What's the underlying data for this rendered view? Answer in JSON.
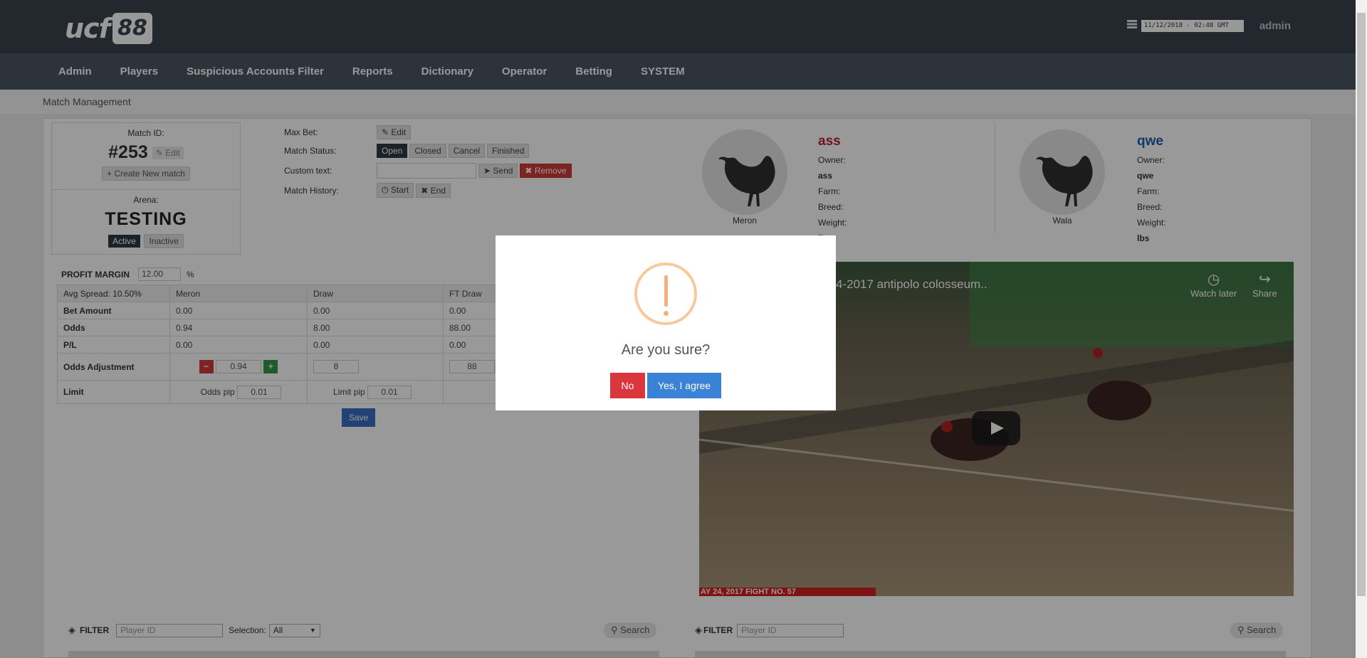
{
  "brand": {
    "logo_part1": "ucf",
    "logo_part2": "88"
  },
  "header": {
    "datetime": "11/12/2018 - 02:48 GMT",
    "user": "admin"
  },
  "nav": {
    "items": [
      "Admin",
      "Players",
      "Suspicious Accounts Filter",
      "Reports",
      "Dictionary",
      "Operator",
      "Betting",
      "SYSTEM"
    ]
  },
  "breadcrumb": "Match Management",
  "match": {
    "id_label": "Match ID:",
    "id": "#253",
    "edit_label": "Edit",
    "create_label": "Create New match",
    "arena_label": "Arena:",
    "arena": "TESTING",
    "active_label": "Active",
    "inactive_label": "Inactive"
  },
  "controls": {
    "max_bet_label": "Max Bet:",
    "edit_label": "Edit",
    "status_label": "Match Status:",
    "statuses": [
      "Open",
      "Closed",
      "Cancel",
      "Finished"
    ],
    "custom_text_label": "Custom text:",
    "send_label": "Send",
    "remove_label": "Remove",
    "history_label": "Match History:",
    "start_label": "Start",
    "end_label": "End"
  },
  "meron": {
    "caption": "Meron",
    "name": "ass",
    "owner_label": "Owner:",
    "owner": "ass",
    "farm_label": "Farm:",
    "breed_label": "Breed:",
    "weight_label": "Weight:",
    "weight_unit": "lbs",
    "color": "#c0203a"
  },
  "wala": {
    "caption": "Wala",
    "name": "qwe",
    "owner_label": "Owner:",
    "owner": "qwe",
    "farm_label": "Farm:",
    "breed_label": "Breed:",
    "weight_label": "Weight:",
    "weight_unit": "lbs",
    "color": "#1e5fa8"
  },
  "odds": {
    "profit_margin_label": "PROFIT MARGIN",
    "profit_margin": "12.00",
    "pct": "%",
    "avg_spread": "Avg Spread: 10.50%",
    "columns": [
      "Meron",
      "Draw",
      "FT Draw"
    ],
    "rows": {
      "bet_amount": {
        "label": "Bet Amount",
        "values": [
          "0.00",
          "0.00",
          "0.00"
        ]
      },
      "odds": {
        "label": "Odds",
        "values": [
          "0.94",
          "8.00",
          "88.00"
        ]
      },
      "pl": {
        "label": "P/L",
        "values": [
          "0.00",
          "0.00",
          "0.00"
        ]
      }
    },
    "adjust_label": "Odds Adjustment",
    "adjust_values": [
      "0.94",
      "8",
      "88"
    ],
    "limit_label": "Limit",
    "odds_pip_label": "Odds pip",
    "odds_pip": "0.01",
    "limit_pip_label": "Limit pip",
    "limit_pip": "0.01",
    "save_label": "Save"
  },
  "video": {
    "title": "4-2017 antipolo colosseum..",
    "watch_later": "Watch later",
    "share": "Share",
    "caption": "AY 24, 2017  FIGHT NO. 57"
  },
  "filters": {
    "left": {
      "label": "FILTER",
      "player_placeholder": "Player ID",
      "selection_label": "Selection:",
      "selection_value": "All",
      "search_label": "Search"
    },
    "right": {
      "label": "FILTER",
      "player_placeholder": "Player ID",
      "search_label": "Search"
    }
  },
  "modal": {
    "question": "Are you sure?",
    "no_label": "No",
    "yes_label": "Yes, I agree"
  }
}
